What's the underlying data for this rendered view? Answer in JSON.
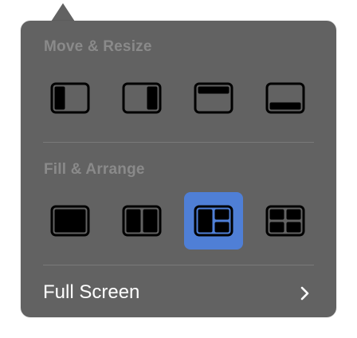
{
  "colors": {
    "background": "#626262",
    "accent": "#4f7fd6",
    "section_label": "#8a8a8a",
    "text": "#ffffff"
  },
  "move_resize": {
    "title": "Move & Resize",
    "options": [
      {
        "icon": "left-half-icon",
        "selected": false
      },
      {
        "icon": "right-half-icon",
        "selected": false
      },
      {
        "icon": "top-half-icon",
        "selected": false
      },
      {
        "icon": "bottom-half-icon",
        "selected": false
      }
    ]
  },
  "fill_arrange": {
    "title": "Fill & Arrange",
    "options": [
      {
        "icon": "fill-icon",
        "selected": false
      },
      {
        "icon": "two-columns-icon",
        "selected": false
      },
      {
        "icon": "one-left-two-right-icon",
        "selected": true
      },
      {
        "icon": "four-quadrants-icon",
        "selected": false
      }
    ]
  },
  "full_screen": {
    "label": "Full Screen",
    "icon": "chevron-right-icon"
  }
}
